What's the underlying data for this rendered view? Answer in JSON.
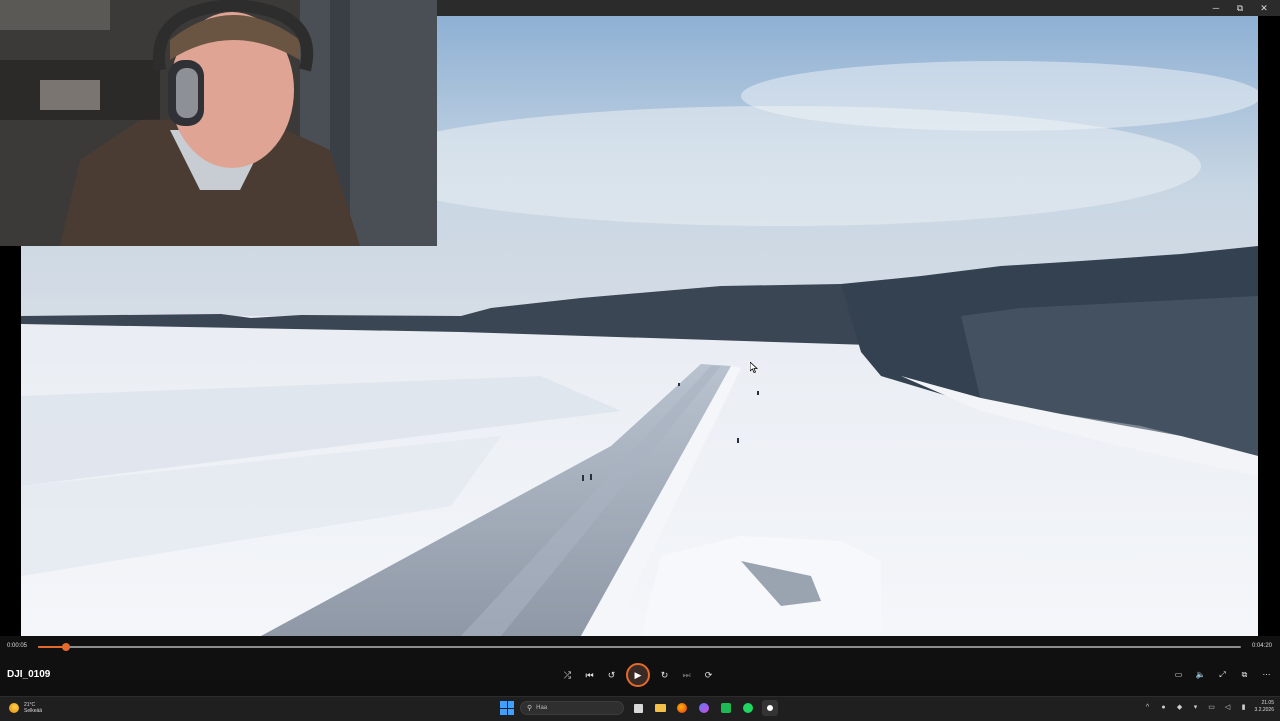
{
  "window": {
    "controls": {
      "minimize": "─",
      "restore": "⧉",
      "close": "✕"
    }
  },
  "player": {
    "title": "DJI_0109",
    "current_time": "0:00:05",
    "total_time": "0:04:20",
    "progress": 0.023,
    "accent_color": "#e46a2c",
    "controls": {
      "shuffle_icon": "⤮",
      "previous_icon": "⏮",
      "rewind_icon": "↺",
      "play_icon": "▶",
      "forward_icon": "↻",
      "next_icon": "⏭",
      "repeat_icon": "⟳"
    },
    "right_controls": {
      "subtitles_icon": "▭",
      "volume_icon": "🔈",
      "fullscreen_icon": "⤢",
      "miniplayer_icon": "⧉",
      "more_icon": "⋯"
    }
  },
  "taskbar": {
    "weather": {
      "temp": "21°C",
      "condition": "Selkeää"
    },
    "search_placeholder": "Haa",
    "clock": {
      "time": "21.05",
      "date": "3.2.2026"
    },
    "apps": [
      "file-explorer",
      "folder",
      "firefox",
      "messenger",
      "game-app",
      "spotify",
      "media-player"
    ]
  }
}
